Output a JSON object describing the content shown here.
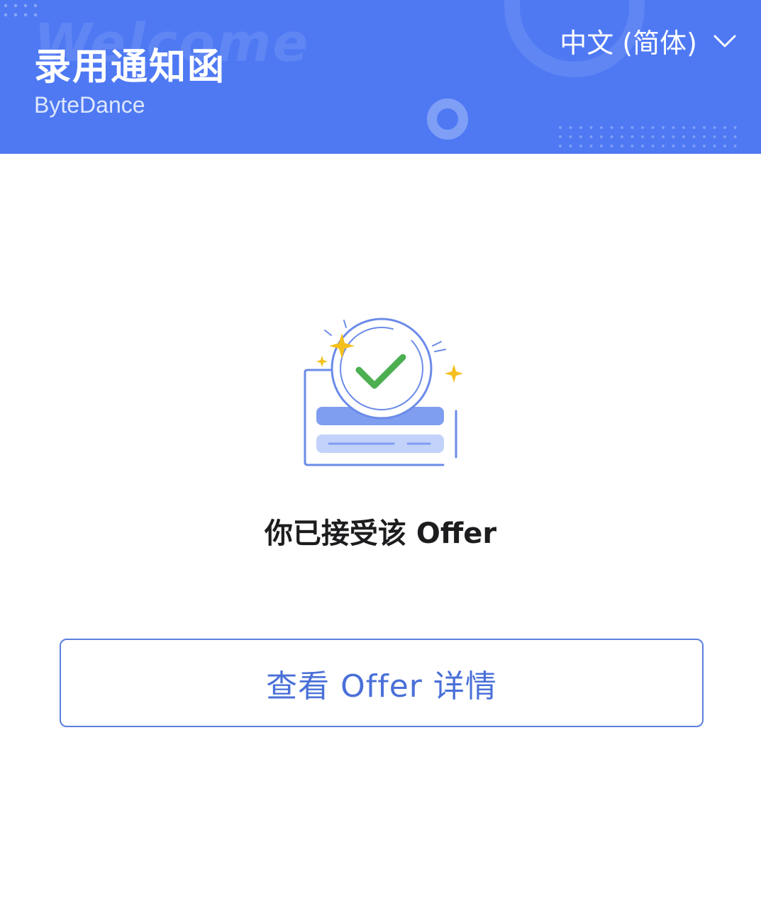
{
  "header": {
    "watermark": "Welcome",
    "title": "录用通知函",
    "company": "ByteDance",
    "language_label": "中文 (简体)",
    "language_icon": "chevron-down-icon",
    "background_color": "#4e79f3"
  },
  "main": {
    "illustration_icon": "offer-accepted-checkmark-icon",
    "status_text": "你已接受该 Offer",
    "view_button_label": "查看 Offer 详情"
  },
  "colors": {
    "accent": "#4a70d8",
    "check": "#4caf50",
    "star": "#f5c01e"
  }
}
